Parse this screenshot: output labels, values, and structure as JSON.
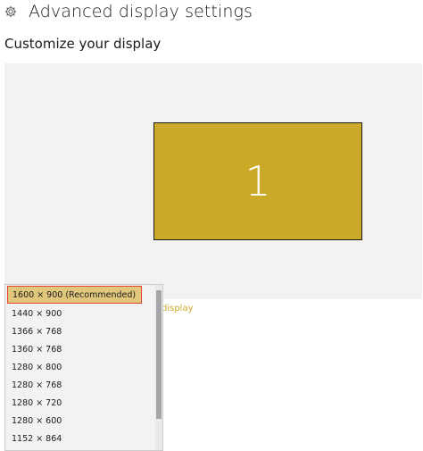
{
  "header": {
    "title": "Advanced display settings",
    "icon": "gear-icon"
  },
  "section": {
    "title": "Customize your display"
  },
  "arrangement": {
    "monitor_label": "1",
    "monitor_color": "#ccaa29"
  },
  "link": {
    "partial_text": "display",
    "color": "#ccaa29"
  },
  "resolution_dropdown": {
    "selected": "1600 × 900 (Recommended)",
    "options": [
      "1600 × 900 (Recommended)",
      "1440 × 900",
      "1366 × 768",
      "1360 × 768",
      "1280 × 800",
      "1280 × 768",
      "1280 × 720",
      "1280 × 600",
      "1152 × 864"
    ],
    "highlight_color": "#e0c77c",
    "selection_border_color": "#e34234"
  }
}
